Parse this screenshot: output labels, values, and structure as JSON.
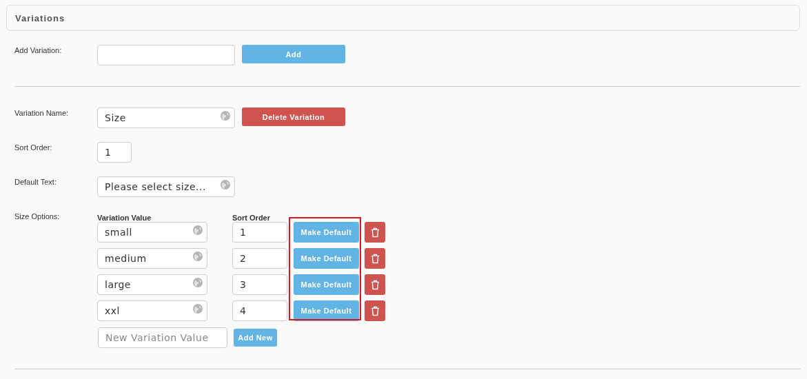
{
  "panel": {
    "title": "Variations"
  },
  "add_variation": {
    "label": "Add Variation:",
    "button": "Add"
  },
  "variation": {
    "name_label": "Variation Name:",
    "name": "Size",
    "delete_button": "Delete Variation",
    "sort_label": "Sort Order:",
    "sort_order": "1",
    "default_label": "Default Text:",
    "default_text": "Please select size...",
    "options_label": "Size Options:",
    "value_header": "Variation Value",
    "sort_header": "Sort Order",
    "options": [
      {
        "value": "small",
        "sort_order": "1",
        "button": "Make Default"
      },
      {
        "value": "medium",
        "sort_order": "2",
        "button": "Make Default"
      },
      {
        "value": "large",
        "sort_order": "3",
        "button": "Make Default"
      },
      {
        "value": "xxl",
        "sort_order": "4",
        "button": "Make Default"
      }
    ],
    "new_value": {
      "placeholder": "New Variation Value",
      "button": "Add New"
    }
  }
}
